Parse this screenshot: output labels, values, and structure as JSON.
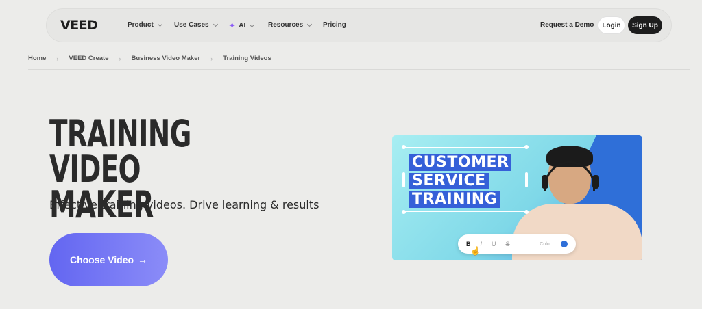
{
  "nav": {
    "logo": "VEED",
    "items": [
      {
        "label": "Product",
        "has_dropdown": true
      },
      {
        "label": "Use Cases",
        "has_dropdown": true
      },
      {
        "label": "AI",
        "has_dropdown": true,
        "icon": "sparkle-icon"
      },
      {
        "label": "Resources",
        "has_dropdown": true
      },
      {
        "label": "Pricing",
        "has_dropdown": false
      }
    ],
    "request_demo": "Request a Demo",
    "login": "Login",
    "signup": "Sign Up"
  },
  "breadcrumb": [
    "Home",
    "VEED Create",
    "Business Video Maker",
    "Training Videos"
  ],
  "hero": {
    "title_line1": "TRAINING VIDEO",
    "title_line2": "MAKER",
    "subtitle": "Effective training videos. Drive learning & results",
    "cta": "Choose Video",
    "cta_icon": "arrow-right-icon"
  },
  "hero_image": {
    "caption_lines": [
      "CUSTOMER",
      "SERVICE",
      "TRAINING"
    ],
    "toolbar": {
      "bold": "B",
      "italic": "I",
      "underline": "U",
      "strike": "S",
      "color_label": "Color"
    },
    "accent_color": "#2f6fd8"
  },
  "colors": {
    "cta_start": "#6366f1",
    "cta_end": "#8b8cf8",
    "signup_bg": "#1d1d1d"
  }
}
